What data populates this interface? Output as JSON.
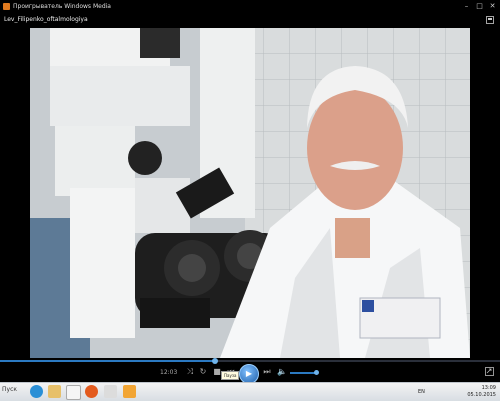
{
  "window": {
    "title": "Проигрыватель Windows Media"
  },
  "filebar": {
    "filename": "Lev_Filipenko_oftalmologiya"
  },
  "controls": {
    "elapsed": "12:03",
    "seek_progress": 0.43,
    "volume_level": 0.9,
    "tooltip": "Пауза"
  },
  "taskbar": {
    "start_label": "Пуск",
    "lang": "EN",
    "time": "13:09",
    "date": "05.10.2015"
  },
  "colors": {
    "accent": "#2b79c2",
    "taskbar": "#e6e9ed"
  }
}
